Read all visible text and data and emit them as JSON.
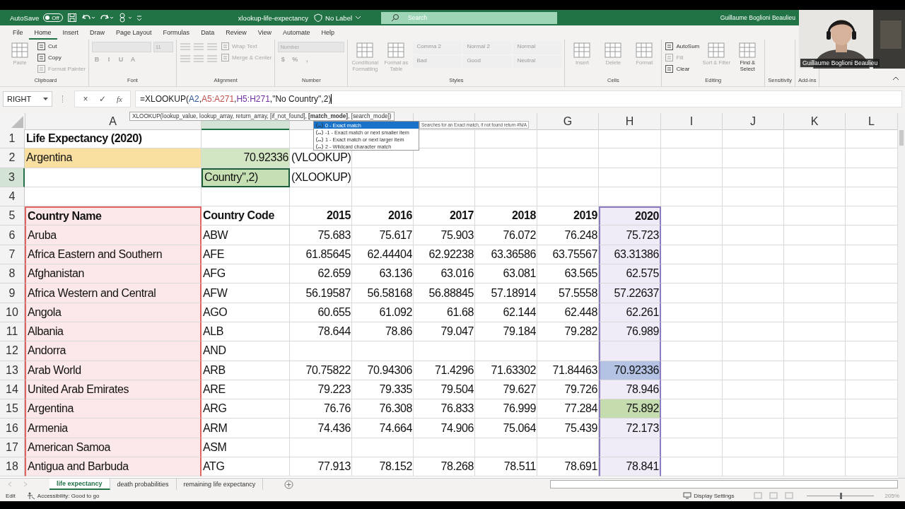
{
  "title_bar": {
    "autosave_label": "AutoSave",
    "autosave_toggle": {
      "text": "Off",
      "on": false
    },
    "file_name": "xlookup-life-expectancy",
    "sensitivity_label": "No Label",
    "search_placeholder": "Search",
    "user_name": "Guillaume Boglioni Beaulieu"
  },
  "menu_tabs": [
    {
      "label": "File",
      "selected": false
    },
    {
      "label": "Home",
      "selected": true
    },
    {
      "label": "Insert",
      "selected": false
    },
    {
      "label": "Draw",
      "selected": false
    },
    {
      "label": "Page Layout",
      "selected": false
    },
    {
      "label": "Formulas",
      "selected": false
    },
    {
      "label": "Data",
      "selected": false
    },
    {
      "label": "Review",
      "selected": false
    },
    {
      "label": "View",
      "selected": false
    },
    {
      "label": "Automate",
      "selected": false
    },
    {
      "label": "Help",
      "selected": false
    }
  ],
  "ribbon": {
    "groups": [
      {
        "label": "Clipboard",
        "columns": [
          [
            [
              {
                "kind": "large",
                "text": "Paste",
                "disabled": true
              }
            ]
          ],
          [
            [
              {
                "kind": "small",
                "text": "Cut",
                "disabled": false
              }
            ],
            [
              {
                "kind": "small",
                "text": "Copy",
                "disabled": false
              }
            ],
            [
              {
                "kind": "small",
                "text": "Format Painter",
                "disabled": true
              }
            ]
          ]
        ]
      },
      {
        "label": "Font",
        "columns": [
          [
            [
              {
                "kind": "field",
                "disabled": true
              },
              {
                "kind": "field",
                "text": "11",
                "disabled": true
              }
            ],
            [
              {
                "kind": "glyph",
                "text": "B",
                "disabled": true
              },
              {
                "kind": "glyph",
                "text": "I",
                "disabled": true
              },
              {
                "kind": "glyph",
                "text": "U",
                "disabled": true
              },
              {
                "kind": "glyph",
                "text": "A",
                "disabled": true
              }
            ]
          ]
        ]
      },
      {
        "label": "Alignment",
        "columns": [
          [
            [
              {
                "kind": "icon",
                "disabled": true
              },
              {
                "kind": "icon",
                "disabled": true
              },
              {
                "kind": "icon",
                "disabled": true
              }
            ],
            [
              {
                "kind": "icon",
                "disabled": true
              },
              {
                "kind": "icon",
                "disabled": true
              },
              {
                "kind": "icon",
                "disabled": true
              }
            ]
          ],
          [
            [
              {
                "kind": "small",
                "text": "Wrap Text",
                "disabled": true
              }
            ],
            [
              {
                "kind": "small",
                "text": "Merge & Center",
                "disabled": true
              }
            ]
          ]
        ]
      },
      {
        "label": "Number",
        "columns": [
          [
            [
              {
                "kind": "field",
                "text": "Number",
                "disabled": true
              }
            ],
            [
              {
                "kind": "glyph",
                "text": "$",
                "disabled": true
              },
              {
                "kind": "glyph",
                "text": "%",
                "disabled": true
              },
              {
                "kind": "glyph",
                "text": ",",
                "disabled": true
              }
            ]
          ]
        ]
      },
      {
        "label": "Styles",
        "columns": [
          [
            [
              {
                "kind": "large",
                "text": "Conditional Formatting",
                "disabled": true
              }
            ]
          ],
          [
            [
              {
                "kind": "large",
                "text": "Format as Table",
                "disabled": true
              }
            ]
          ],
          [
            [
              {
                "kind": "style",
                "text": "Comma 2",
                "disabled": true
              },
              {
                "kind": "style",
                "text": "Normal 2",
                "disabled": true
              },
              {
                "kind": "style",
                "text": "Normal",
                "disabled": true
              }
            ],
            [
              {
                "kind": "style",
                "text": "Bad",
                "disabled": true
              },
              {
                "kind": "style",
                "text": "Good",
                "disabled": true
              },
              {
                "kind": "style",
                "text": "Neutral",
                "disabled": true
              }
            ]
          ]
        ]
      },
      {
        "label": "Cells",
        "columns": [
          [
            [
              {
                "kind": "large",
                "text": "Insert",
                "disabled": true
              }
            ]
          ],
          [
            [
              {
                "kind": "large",
                "text": "Delete",
                "disabled": true
              }
            ]
          ],
          [
            [
              {
                "kind": "large",
                "text": "Format",
                "disabled": true
              }
            ]
          ]
        ]
      },
      {
        "label": "Editing",
        "columns": [
          [
            [
              {
                "kind": "small",
                "text": "AutoSum",
                "disabled": false
              }
            ],
            [
              {
                "kind": "small",
                "text": "Fill",
                "disabled": true
              }
            ],
            [
              {
                "kind": "small",
                "text": "Clear",
                "disabled": false
              }
            ]
          ],
          [
            [
              {
                "kind": "large",
                "text": "Sort & Filter",
                "disabled": true
              }
            ]
          ],
          [
            [
              {
                "kind": "large",
                "text": "Find & Select",
                "disabled": false
              }
            ]
          ]
        ]
      },
      {
        "label": "Sensitivity"
      },
      {
        "label": "Add-ins"
      }
    ]
  },
  "webcam": {
    "name": "Guillaume Boglioni Beaulieu"
  },
  "formula_bar": {
    "name_box": "RIGHT",
    "buttons": [
      "×",
      "✓",
      "fx"
    ],
    "formula": [
      {
        "text": "=XLOOKUP("
      },
      {
        "text": "A2",
        "color": "#2f5597"
      },
      {
        "text": ","
      },
      {
        "text": "A5:A271",
        "color": "#c0504d"
      },
      {
        "text": ","
      },
      {
        "text": "H5:H271",
        "color": "#7030a0"
      },
      {
        "text": ",\"No Country\",2)"
      }
    ]
  },
  "function_tooltip": {
    "signature": "XLOOKUP(lookup_value, lookup_array, return_array, [if_not_found], **[match_mode]**, [search_mode])"
  },
  "autocomplete": {
    "items": [
      {
        "text": "0 - Exact match",
        "selected": true
      },
      {
        "text": "-1 - Exact match or next smaller item",
        "selected": false
      },
      {
        "text": "1 - Exact match or next larger item",
        "selected": false
      },
      {
        "text": "2 - Wildcard character match",
        "selected": false
      }
    ],
    "description": "Searches for an Exact match, if not found return #N/A"
  },
  "sheet": {
    "columns": [
      {
        "label": "A",
        "selected": false,
        "color": "#e06666"
      },
      {
        "selected": true
      },
      {
        "selected": false
      },
      {
        "selected": false
      },
      {
        "selected": false
      },
      {
        "selected": false
      },
      {
        "label": "G",
        "selected": false
      },
      {
        "label": "H",
        "selected": false,
        "color": "#8e7cc3"
      },
      {
        "label": "I",
        "selected": false
      },
      {
        "label": "J",
        "selected": false
      },
      {
        "label": "K",
        "selected": false
      },
      {
        "label": "L",
        "selected": false
      }
    ],
    "rows": [
      {
        "number": "1",
        "selected": false,
        "in_range": false,
        "kind": "title",
        "cells": [
          {
            "text": "Life Expectancy (2020)"
          }
        ]
      },
      {
        "number": "2",
        "selected": false,
        "in_range": false,
        "kind": "data",
        "cells": [
          {
            "text": "Argentina",
            "color": "#f9dfa0"
          },
          {
            "text": "70.92336",
            "kind": "number",
            "color": "#d3e6c3"
          },
          {
            "text": "(VLOOKUP)"
          }
        ]
      },
      {
        "number": "3",
        "selected": true,
        "in_range": false,
        "kind": "data",
        "cells": [
          {},
          {
            "text": "Country\",2)",
            "color": "#c6e0b4"
          },
          {
            "text": "(XLOOKUP)"
          }
        ]
      },
      {
        "number": "4",
        "selected": false,
        "in_range": false,
        "kind": "data",
        "cells": []
      },
      {
        "number": "5",
        "selected": false,
        "in_range": true,
        "kind": "header",
        "cells": [
          {
            "text": "Country Name",
            "color": "#fce8e8"
          },
          {
            "text": "Country Code"
          },
          {
            "text": "2015",
            "kind": "number"
          },
          {
            "text": "2016",
            "kind": "number"
          },
          {
            "text": "2017",
            "kind": "number"
          },
          {
            "text": "2018",
            "kind": "number"
          },
          {
            "text": "2019",
            "kind": "number"
          },
          {
            "text": "2020",
            "kind": "number",
            "color": "#efebf7"
          }
        ]
      },
      {
        "number": "6",
        "selected": false,
        "in_range": true,
        "kind": "data",
        "cells": [
          {
            "text": "Aruba",
            "color": "#fce8e8"
          },
          {
            "text": "ABW"
          },
          {
            "text": "75.683",
            "kind": "number"
          },
          {
            "text": "75.617",
            "kind": "number"
          },
          {
            "text": "75.903",
            "kind": "number"
          },
          {
            "text": "76.072",
            "kind": "number"
          },
          {
            "text": "76.248",
            "kind": "number"
          },
          {
            "text": "75.723",
            "kind": "number",
            "color": "#efebf7"
          }
        ]
      },
      {
        "number": "7",
        "selected": false,
        "in_range": true,
        "kind": "data",
        "cells": [
          {
            "text": "Africa Eastern and Southern",
            "color": "#fce8e8"
          },
          {
            "text": "AFE"
          },
          {
            "text": "61.85645",
            "kind": "number"
          },
          {
            "text": "62.44404",
            "kind": "number"
          },
          {
            "text": "62.92238",
            "kind": "number"
          },
          {
            "text": "63.36586",
            "kind": "number"
          },
          {
            "text": "63.75567",
            "kind": "number"
          },
          {
            "text": "63.31386",
            "kind": "number",
            "color": "#efebf7"
          }
        ]
      },
      {
        "number": "8",
        "selected": false,
        "in_range": true,
        "kind": "data",
        "cells": [
          {
            "text": "Afghanistan",
            "color": "#fce8e8"
          },
          {
            "text": "AFG"
          },
          {
            "text": "62.659",
            "kind": "number"
          },
          {
            "text": "63.136",
            "kind": "number"
          },
          {
            "text": "63.016",
            "kind": "number"
          },
          {
            "text": "63.081",
            "kind": "number"
          },
          {
            "text": "63.565",
            "kind": "number"
          },
          {
            "text": "62.575",
            "kind": "number",
            "color": "#efebf7"
          }
        ]
      },
      {
        "number": "9",
        "selected": false,
        "in_range": true,
        "kind": "data",
        "cells": [
          {
            "text": "Africa Western and Central",
            "color": "#fce8e8"
          },
          {
            "text": "AFW"
          },
          {
            "text": "56.19587",
            "kind": "number"
          },
          {
            "text": "56.58168",
            "kind": "number"
          },
          {
            "text": "56.88845",
            "kind": "number"
          },
          {
            "text": "57.18914",
            "kind": "number"
          },
          {
            "text": "57.5558",
            "kind": "number"
          },
          {
            "text": "57.22637",
            "kind": "number",
            "color": "#efebf7"
          }
        ]
      },
      {
        "number": "10",
        "selected": false,
        "in_range": true,
        "kind": "data",
        "cells": [
          {
            "text": "Angola",
            "color": "#fce8e8"
          },
          {
            "text": "AGO"
          },
          {
            "text": "60.655",
            "kind": "number"
          },
          {
            "text": "61.092",
            "kind": "number"
          },
          {
            "text": "61.68",
            "kind": "number"
          },
          {
            "text": "62.144",
            "kind": "number"
          },
          {
            "text": "62.448",
            "kind": "number"
          },
          {
            "text": "62.261",
            "kind": "number",
            "color": "#efebf7"
          }
        ]
      },
      {
        "number": "11",
        "selected": false,
        "in_range": true,
        "kind": "data",
        "cells": [
          {
            "text": "Albania",
            "color": "#fce8e8"
          },
          {
            "text": "ALB"
          },
          {
            "text": "78.644",
            "kind": "number"
          },
          {
            "text": "78.86",
            "kind": "number"
          },
          {
            "text": "79.047",
            "kind": "number"
          },
          {
            "text": "79.184",
            "kind": "number"
          },
          {
            "text": "79.282",
            "kind": "number"
          },
          {
            "text": "76.989",
            "kind": "number",
            "color": "#efebf7"
          }
        ]
      },
      {
        "number": "12",
        "selected": false,
        "in_range": true,
        "kind": "data",
        "cells": [
          {
            "text": "Andorra",
            "color": "#fce8e8"
          },
          {
            "text": "AND"
          },
          {},
          {},
          {},
          {},
          {},
          {
            "color": "#efebf7"
          }
        ]
      },
      {
        "number": "13",
        "selected": false,
        "in_range": true,
        "kind": "data",
        "cells": [
          {
            "text": "Arab World",
            "color": "#fce8e8"
          },
          {
            "text": "ARB"
          },
          {
            "text": "70.75822",
            "kind": "number"
          },
          {
            "text": "70.94306",
            "kind": "number"
          },
          {
            "text": "71.4296",
            "kind": "number"
          },
          {
            "text": "71.63302",
            "kind": "number"
          },
          {
            "text": "71.84463",
            "kind": "number"
          },
          {
            "text": "70.92336",
            "kind": "number",
            "color": "#b4c3e4"
          }
        ]
      },
      {
        "number": "14",
        "selected": false,
        "in_range": true,
        "kind": "data",
        "cells": [
          {
            "text": "United Arab Emirates",
            "color": "#fce8e8"
          },
          {
            "text": "ARE"
          },
          {
            "text": "79.223",
            "kind": "number"
          },
          {
            "text": "79.335",
            "kind": "number"
          },
          {
            "text": "79.504",
            "kind": "number"
          },
          {
            "text": "79.627",
            "kind": "number"
          },
          {
            "text": "79.726",
            "kind": "number"
          },
          {
            "text": "78.946",
            "kind": "number",
            "color": "#efebf7"
          }
        ]
      },
      {
        "number": "15",
        "selected": false,
        "in_range": true,
        "kind": "data",
        "cells": [
          {
            "text": "Argentina",
            "color": "#fce8e8"
          },
          {
            "text": "ARG"
          },
          {
            "text": "76.76",
            "kind": "number"
          },
          {
            "text": "76.308",
            "kind": "number"
          },
          {
            "text": "76.833",
            "kind": "number"
          },
          {
            "text": "76.999",
            "kind": "number"
          },
          {
            "text": "77.284",
            "kind": "number"
          },
          {
            "text": "75.892",
            "kind": "number",
            "color": "#c5dcae"
          }
        ]
      },
      {
        "number": "16",
        "selected": false,
        "in_range": true,
        "kind": "data",
        "cells": [
          {
            "text": "Armenia",
            "color": "#fce8e8"
          },
          {
            "text": "ARM"
          },
          {
            "text": "74.436",
            "kind": "number"
          },
          {
            "text": "74.664",
            "kind": "number"
          },
          {
            "text": "74.906",
            "kind": "number"
          },
          {
            "text": "75.064",
            "kind": "number"
          },
          {
            "text": "75.439",
            "kind": "number"
          },
          {
            "text": "72.173",
            "kind": "number",
            "color": "#efebf7"
          }
        ]
      },
      {
        "number": "17",
        "selected": false,
        "in_range": true,
        "kind": "data",
        "cells": [
          {
            "text": "American Samoa",
            "color": "#fce8e8"
          },
          {
            "text": "ASM"
          },
          {},
          {},
          {},
          {},
          {},
          {
            "color": "#efebf7"
          }
        ]
      },
      {
        "number": "18",
        "selected": false,
        "in_range": true,
        "kind": "data",
        "cells": [
          {
            "text": "Antigua and Barbuda",
            "color": "#fce8e8"
          },
          {
            "text": "ATG"
          },
          {
            "text": "77.913",
            "kind": "number"
          },
          {
            "text": "78.152",
            "kind": "number"
          },
          {
            "text": "78.268",
            "kind": "number"
          },
          {
            "text": "78.511",
            "kind": "number"
          },
          {
            "text": "78.691",
            "kind": "number"
          },
          {
            "text": "78.841",
            "kind": "number",
            "color": "#efebf7"
          }
        ]
      }
    ]
  },
  "sheet_tabs": [
    {
      "label": "life expectancy",
      "selected": true
    },
    {
      "label": "death probabilities",
      "selected": false
    },
    {
      "label": "remaining life expectancy",
      "selected": false
    }
  ],
  "status_bar": {
    "mode": "Edit",
    "accessibility": "Accessibility: Good to go",
    "display_settings": "Display Settings",
    "zoom_slider": {
      "level": 0.5
    },
    "zoom": "205%"
  }
}
